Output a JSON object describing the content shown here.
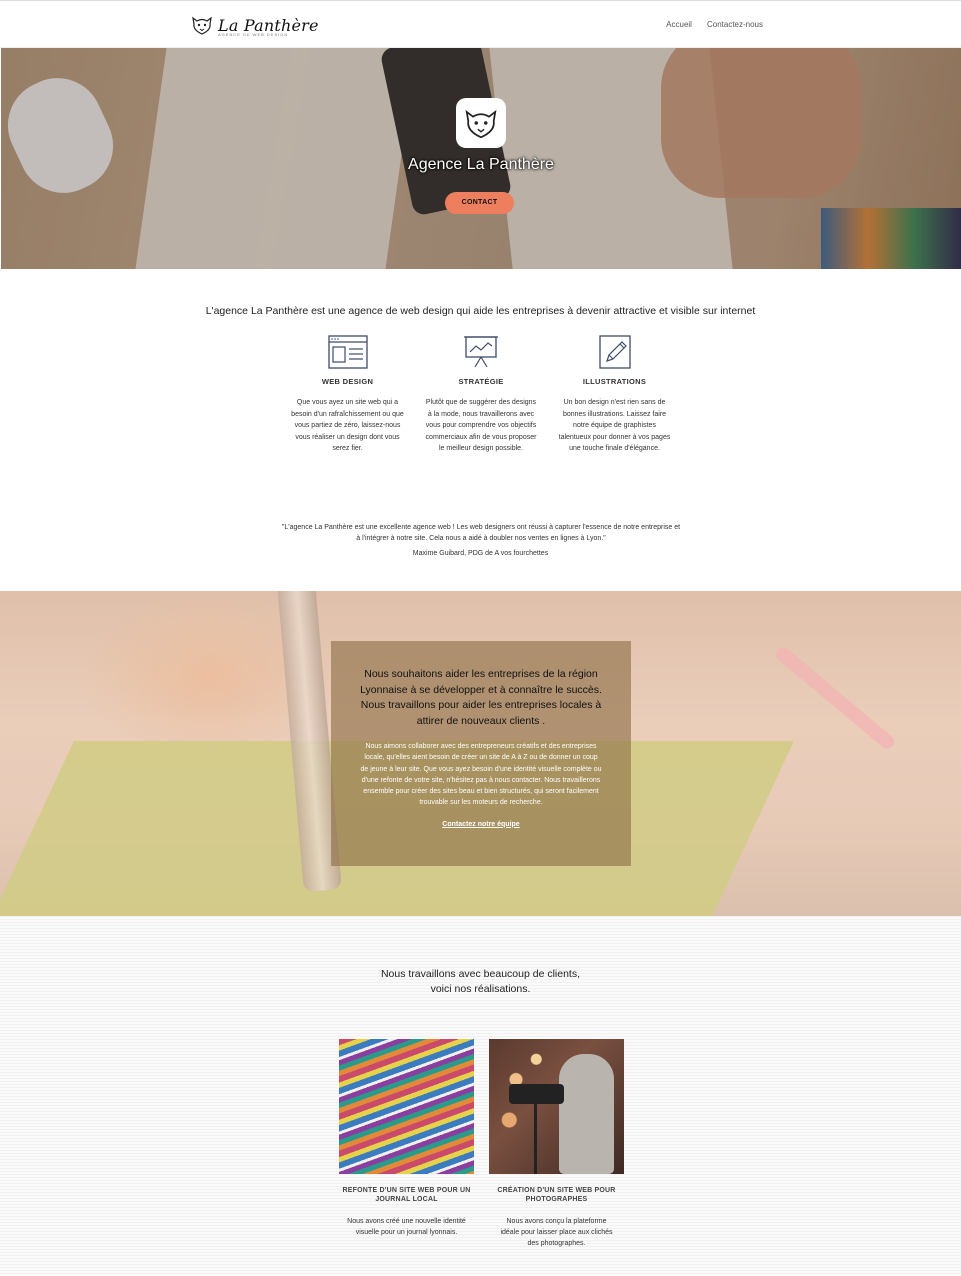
{
  "nav": {
    "logo_text": "La Panthère",
    "logo_tagline": "AGENCE DE WEB DESIGN",
    "links": [
      "Accueil",
      "Contactez-nous"
    ]
  },
  "hero": {
    "title": "Agence La Panthère",
    "button": "CONTACT"
  },
  "intro": {
    "text": "L'agence La Panthère est une agence de web design qui aide les entreprises à devenir attractive et visible sur internet"
  },
  "services": [
    {
      "icon": "browser-window-icon",
      "title": "WEB DESIGN",
      "text": "Que vous ayez un site web qui a besoin d'un rafraîchissement ou que vous partiez de zéro, laissez-nous vous réaliser un design dont vous serez fier."
    },
    {
      "icon": "presentation-chart-icon",
      "title": "STRATÉGIE",
      "text": "Plutôt que de suggérer des designs à la mode, nous travaillerons avec vous pour comprendre vos objectifs commerciaux afin de vous proposer le meilleur design possible."
    },
    {
      "icon": "pencil-square-icon",
      "title": "ILLUSTRATIONS",
      "text": "Un bon design n'est rien sans de bonnes illustrations. Laissez faire notre équipe de graphistes talentueux pour donner à vos pages une touche finale d'élégance."
    }
  ],
  "testimonial": {
    "quote": "\"L'agence La Panthère est une excellente agence web ! Les web designers ont réussi à capturer l'essence de notre entreprise et à l'intégrer à notre site. Cela nous a aidé à doubler nos ventes en lignes à Lyon.\"",
    "author": "Maxime Guibard, PDG de A vos fourchettes"
  },
  "about": {
    "lead": "Nous souhaitons aider les entreprises de la région Lyonnaise à se développer et à connaître le succès. Nous travaillons pour aider les entreprises locales à attirer de nouveaux clients .",
    "body": "Nous aimons collaborer avec des entrepreneurs créatifs et des entreprises locale, qu'elles aient besoin de créer un site de A à Z ou de donner un coup de jeune à leur site. Que vous ayez besoin d'une identité visuelle complète ou d'une refonte de votre site, n'hésitez pas à nous contacter. Nous travaillerons ensemble pour créer des sites beau et bien structurés, qui seront facilement trouvable sur les moteurs de recherche.",
    "link": "Contactez notre équipe"
  },
  "portfolio": {
    "title_line1": "Nous travaillons avec beaucoup de clients,",
    "title_line2": "voici nos réalisations.",
    "items": [
      {
        "title": "REFONTE D'UN SITE WEB POUR UN JOURNAL LOCAL",
        "text": "Nous avons créé une nouvelle identité visuelle pour un journal lyonnais."
      },
      {
        "title": "CRÉATION D'UN SITE WEB POUR PHOTOGRAPHES",
        "text": "Nous avons conçu la plateforme idéale pour laisser place aux clichés des photographes."
      }
    ]
  },
  "colors": {
    "accent_button": "#ee7f5e",
    "card_overlay": "#8c6e46"
  }
}
